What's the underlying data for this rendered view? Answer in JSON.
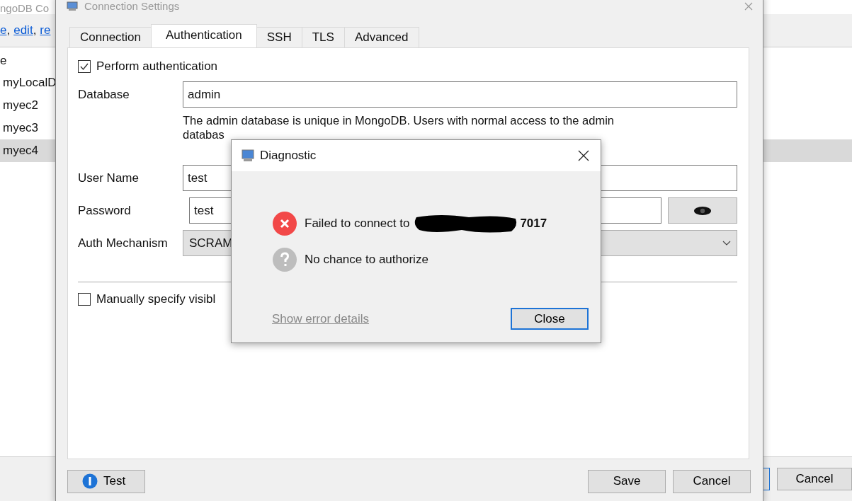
{
  "background_app": {
    "title": "ngoDB Co",
    "links": [
      "e",
      "edit",
      "re"
    ],
    "link_separator": ",",
    "list_header": "e",
    "connections": [
      {
        "label": "myLocalD",
        "selected": false
      },
      {
        "label": "myec2",
        "selected": false
      },
      {
        "label": "myec3",
        "selected": false
      },
      {
        "label": "myec4",
        "selected": true
      }
    ],
    "cancel_button": "Cancel"
  },
  "settings": {
    "title": "Connection Settings",
    "tabs": [
      {
        "label": "Connection",
        "selected": false
      },
      {
        "label": "Authentication",
        "selected": true
      },
      {
        "label": "SSH",
        "selected": false
      },
      {
        "label": "TLS",
        "selected": false
      },
      {
        "label": "Advanced",
        "selected": false
      }
    ],
    "perform_auth": {
      "label": "Perform authentication",
      "checked": true
    },
    "database": {
      "label": "Database",
      "value": "admin"
    },
    "help_text": [
      "The admin database is unique in MongoDB. Users with normal access to the admin",
      "databas"
    ],
    "user_name": {
      "label": "User Name",
      "value": "test"
    },
    "password": {
      "label": "Password",
      "value": "test"
    },
    "auth_mechanism": {
      "label": "Auth Mechanism",
      "value": "SCRAM"
    },
    "manual_visible": {
      "label": "Manually specify visibl",
      "checked": false
    },
    "test_button": "Test",
    "save_button": "Save",
    "cancel_button": "Cancel"
  },
  "dialog": {
    "title": "Diagnostic",
    "messages": [
      {
        "kind": "error",
        "text": "Failed to connect to",
        "redacted": true,
        "suffix": "7017"
      },
      {
        "kind": "unknown",
        "text": "No chance to authorize",
        "redacted": false
      }
    ],
    "details_link": "Show error details",
    "close_button": "Close"
  }
}
